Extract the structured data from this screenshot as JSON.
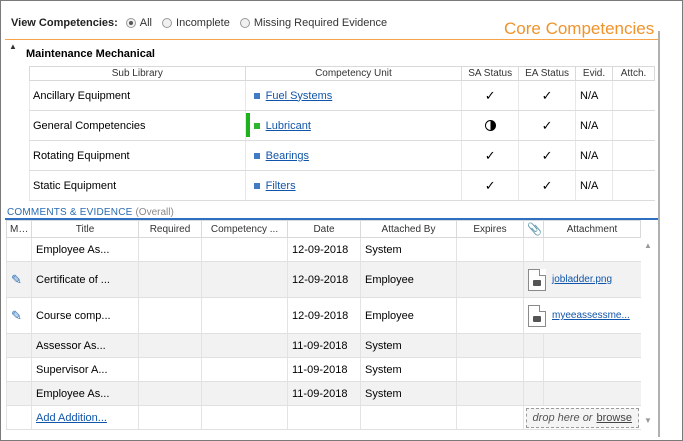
{
  "filter": {
    "label": "View Competencies:",
    "options": [
      "All",
      "Incomplete",
      "Missing Required Evidence"
    ],
    "selected": "All"
  },
  "panel_title": "Core Competencies",
  "section": {
    "title": "Maintenance Mechanical",
    "headers": [
      "Sub Library",
      "Competency Unit",
      "SA Status",
      "EA Status",
      "Evid.",
      "Attch."
    ],
    "rows": [
      {
        "sub_library": "Ancillary Equipment",
        "unit": "Fuel Systems",
        "sa": "✓",
        "ea": "✓",
        "evid": "N/A",
        "attch": ""
      },
      {
        "sub_library": "General Competencies",
        "unit": "Lubricant",
        "sa": "half-circle",
        "ea": "✓",
        "evid": "N/A",
        "attch": ""
      },
      {
        "sub_library": "Rotating Equipment",
        "unit": "Bearings",
        "sa": "✓",
        "ea": "✓",
        "evid": "N/A",
        "attch": ""
      },
      {
        "sub_library": "Static Equipment",
        "unit": "Filters",
        "sa": "✓",
        "ea": "✓",
        "evid": "N/A",
        "attch": ""
      }
    ]
  },
  "comments": {
    "title": "COMMENTS & EVIDENCE",
    "subtitle": "(Overall)",
    "headers": [
      "Modify",
      "Title",
      "Required",
      "Competency ...",
      "Date",
      "Attached By",
      "Expires",
      "",
      "Attachment"
    ],
    "rows": [
      {
        "edit": false,
        "title": "Employee As...",
        "date": "12-09-2018",
        "by": "System",
        "file": ""
      },
      {
        "edit": true,
        "title": "Certificate of ...",
        "date": "12-09-2018",
        "by": "Employee",
        "file": "jobladder.png"
      },
      {
        "edit": true,
        "title": "Course comp...",
        "date": "12-09-2018",
        "by": "Employee",
        "file": "myeeassessme..."
      },
      {
        "edit": false,
        "title": "Assessor As...",
        "date": "11-09-2018",
        "by": "System",
        "file": ""
      },
      {
        "edit": false,
        "title": "Supervisor A...",
        "date": "11-09-2018",
        "by": "System",
        "file": ""
      },
      {
        "edit": false,
        "title": "Employee As...",
        "date": "11-09-2018",
        "by": "System",
        "file": ""
      }
    ],
    "add_label": "Add Addition...",
    "drop_text": "drop here or",
    "browse_label": "browse"
  },
  "colors": {
    "accent": "#f0932b",
    "link": "#1155aa",
    "section_line": "#2f6fbf",
    "status_bar": "#1db21d"
  }
}
